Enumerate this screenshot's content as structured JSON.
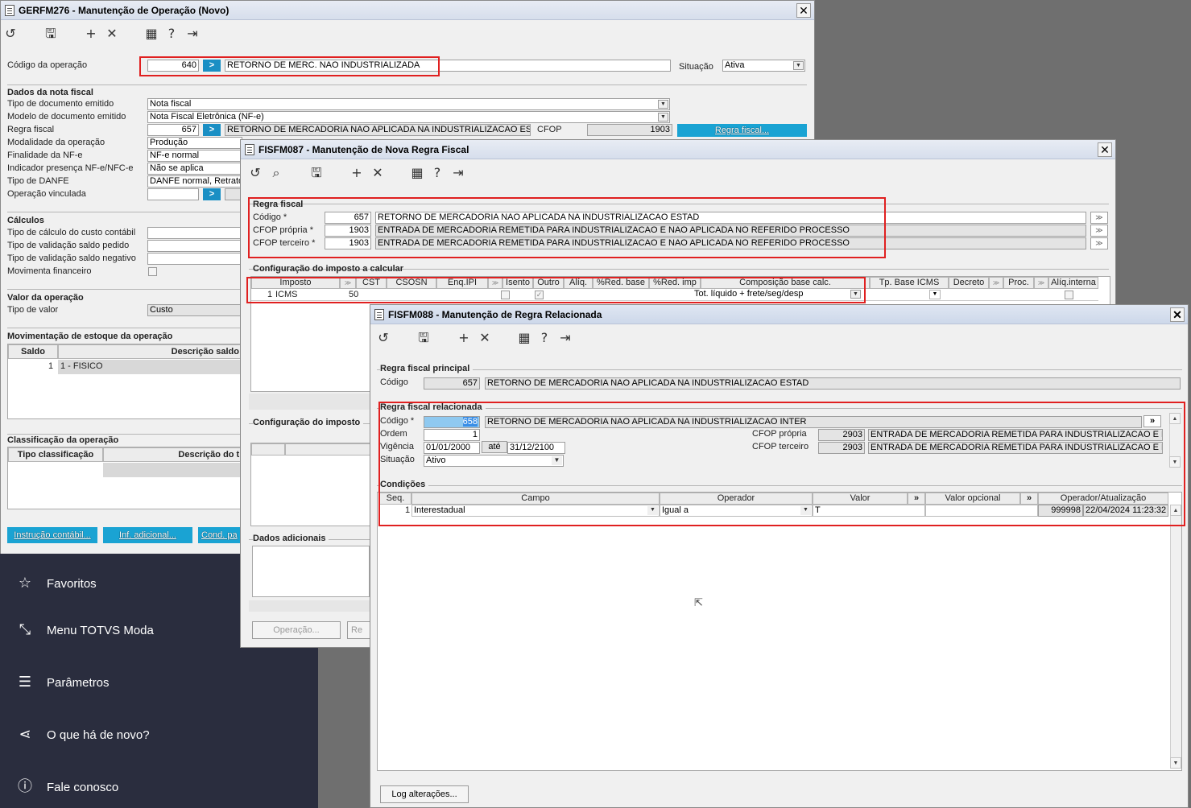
{
  "w1": {
    "title": "GERFM276 - Manutenção de Operação (Novo)",
    "cod_label": "Código da operação",
    "cod_value": "640",
    "cod_desc": "RETORNO DE MERC. NAO INDUSTRIALIZADA",
    "sit_label": "Situação",
    "sit_value": "Ativa",
    "nota_section": "Dados da nota fiscal",
    "tipo_doc_label": "Tipo de documento emitido",
    "tipo_doc_value": "Nota fiscal",
    "modelo_label": "Modelo de documento emitido",
    "modelo_value": "Nota Fiscal Eletrônica (NF-e)",
    "regra_label": "Regra fiscal",
    "regra_value": "657",
    "regra_desc": "RETORNO DE MERCADORIA NAO APLICADA NA INDUSTRIALIZACAO ESTAD",
    "cfop_label": "CFOP",
    "cfop_value": "1903",
    "regra_btn": "Regra fiscal...",
    "modal_label": "Modalidade da operação",
    "modal_value": "Produção",
    "final_label": "Finalidade da NF-e",
    "final_value": "NF-e normal",
    "indic_label": "Indicador presença NF-e/NFC-e",
    "indic_value": "Não se aplica",
    "danfe_label": "Tipo de DANFE",
    "danfe_value": "DANFE normal, Retrato",
    "vinc_label": "Operação vinculada",
    "calc_section": "Cálculos",
    "calc1": "Tipo de cálculo do custo contábil",
    "calc2": "Tipo de validação saldo pedido",
    "calc3": "Tipo de validação saldo negativo",
    "calc4": "Movimenta financeiro",
    "valor_section": "Valor da operação",
    "tipo_valor_label": "Tipo de valor",
    "tipo_valor_value": "Custo",
    "mov_section": "Movimentação de estoque da operação",
    "mov_cols": [
      "Saldo",
      "Descrição saldo"
    ],
    "mov_row": {
      "saldo": "1",
      "desc": "1 - FISICO"
    },
    "class_section": "Classificação da operação",
    "class_cols": [
      "Tipo classificação",
      "Descrição do tip"
    ],
    "btns": [
      "Instrução contábil...",
      "Inf. adicional...",
      "Cond. pa"
    ]
  },
  "sidebar": {
    "items": [
      "Favoritos",
      "Menu TOTVS Moda",
      "Parâmetros",
      "O que há de novo?",
      "Fale conosco"
    ]
  },
  "w2": {
    "title": "FISFM087 - Manutenção de Nova Regra Fiscal",
    "regra_section": "Regra fiscal",
    "codigo_label": "Código *",
    "codigo_value": "657",
    "codigo_desc": "RETORNO DE MERCADORIA NAO APLICADA NA INDUSTRIALIZACAO ESTAD",
    "cfop_p_label": "CFOP própria *",
    "cfop_p_value": "1903",
    "cfop_p_desc": "ENTRADA DE MERCADORIA REMETIDA PARA INDUSTRIALIZACAO E NAO APLICADA NO REFERIDO PROCESSO",
    "cfop_t_label": "CFOP terceiro *",
    "cfop_t_value": "1903",
    "cfop_t_desc": "ENTRADA DE MERCADORIA REMETIDA PARA INDUSTRIALIZACAO E NAO APLICADA NO REFERIDO PROCESSO",
    "config_section": "Configuração do imposto a calcular",
    "cols": [
      "Imposto",
      "CST",
      "CSOSN",
      "Enq.IPI",
      "Isento",
      "Outro",
      "Alíq.",
      "%Red. base",
      "%Red. imp",
      "Composição base calc.",
      "Tp. Base ICMS",
      "Decreto",
      "Proc.",
      "Alíq.interna"
    ],
    "row": {
      "seq": "1",
      "imposto": "ICMS",
      "cst": "50",
      "comp": "Tot. líquido + frete/seg/desp"
    },
    "config2_section": "Configuração do imposto",
    "dados_section": "Dados adicionais",
    "btn_operacao": "Operação...",
    "btn_re": "Re"
  },
  "w3": {
    "title": "FISFM088 - Manutenção de Regra Relacionada",
    "principal_section": "Regra fiscal principal",
    "p_codigo_label": "Código",
    "p_codigo_value": "657",
    "p_codigo_desc": "RETORNO DE MERCADORIA NAO APLICADA NA INDUSTRIALIZACAO ESTAD",
    "rel_section": "Regra fiscal relacionada",
    "r_codigo_label": "Código *",
    "r_codigo_value": "658",
    "r_codigo_desc": "RETORNO DE MERCADORIA NAO APLICADA NA INDUSTRIALIZACAO INTER",
    "ordem_label": "Ordem",
    "ordem_value": "1",
    "vig_label": "Vigência",
    "vig_from": "01/01/2000",
    "ate_label": "até",
    "vig_to": "31/12/2100",
    "sit_label": "Situação",
    "sit_value": "Ativo",
    "cfop_p_label": "CFOP própria",
    "cfop_p_value": "2903",
    "cfop_p_desc": "ENTRADA DE MERCADORIA REMETIDA PARA INDUSTRIALIZACAO E NAO A",
    "cfop_t_label": "CFOP terceiro",
    "cfop_t_value": "2903",
    "cfop_t_desc": "ENTRADA DE MERCADORIA REMETIDA PARA INDUSTRIALIZACAO E NAO A",
    "cond_section": "Condições",
    "cond_cols": [
      "Seq.",
      "Campo",
      "Operador",
      "Valor",
      "Valor opcional",
      "Operador/Atualização"
    ],
    "cond_row": {
      "seq": "1",
      "campo": "Interestadual",
      "operador": "Igual a",
      "valor": "T",
      "opcional": "",
      "user": "999998",
      "date": "22/04/2024 11:23:32"
    },
    "log_btn": "Log alterações..."
  }
}
